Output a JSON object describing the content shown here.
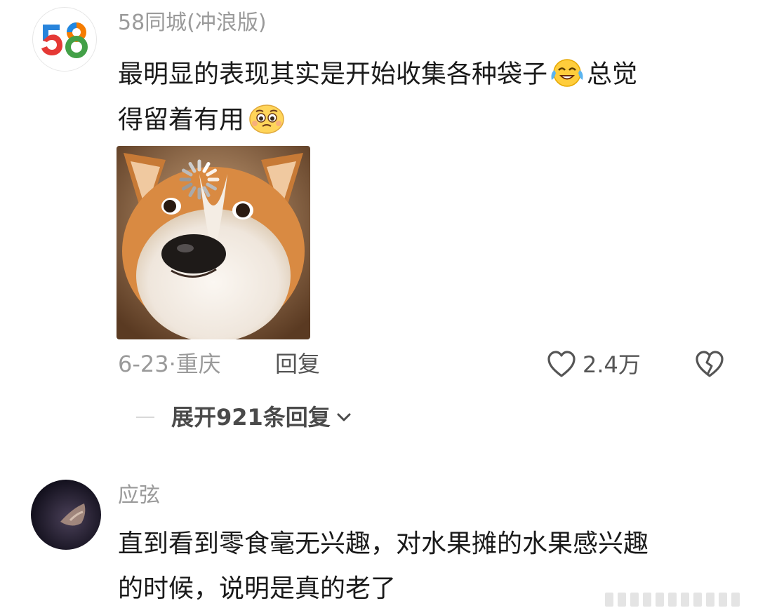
{
  "comments": [
    {
      "avatar": "58-logo",
      "username": "58同城(冲浪版)",
      "content_lines": [
        "最明显的表现其实是开始收集各种袋子",
        "总觉",
        "得留着有用"
      ],
      "emojis": [
        "crying-laughing-emoji",
        "pleading-face-emoji"
      ],
      "image": "corgi-meme-photo",
      "date_location": "6-23·重庆",
      "reply_label": "回复",
      "like_count": "2.4万",
      "expand_replies": "展开921条回复"
    },
    {
      "avatar": "dark-photo-avatar",
      "username": "应弦",
      "content_lines": [
        "直到看到零食毫无兴趣，对水果摊的水果感兴趣",
        "的时候，说明是真的老了"
      ]
    }
  ],
  "icons": {
    "like": "heart-outline-icon",
    "dislike": "broken-heart-icon",
    "expand": "chevron-down-icon"
  },
  "colors": {
    "text_primary": "#1a1a1a",
    "text_secondary": "#9a9a9a",
    "text_meta": "#555555",
    "logo_blue": "#1e88e5",
    "logo_orange": "#f57c00",
    "logo_green": "#43a047",
    "logo_red": "#e53935"
  }
}
